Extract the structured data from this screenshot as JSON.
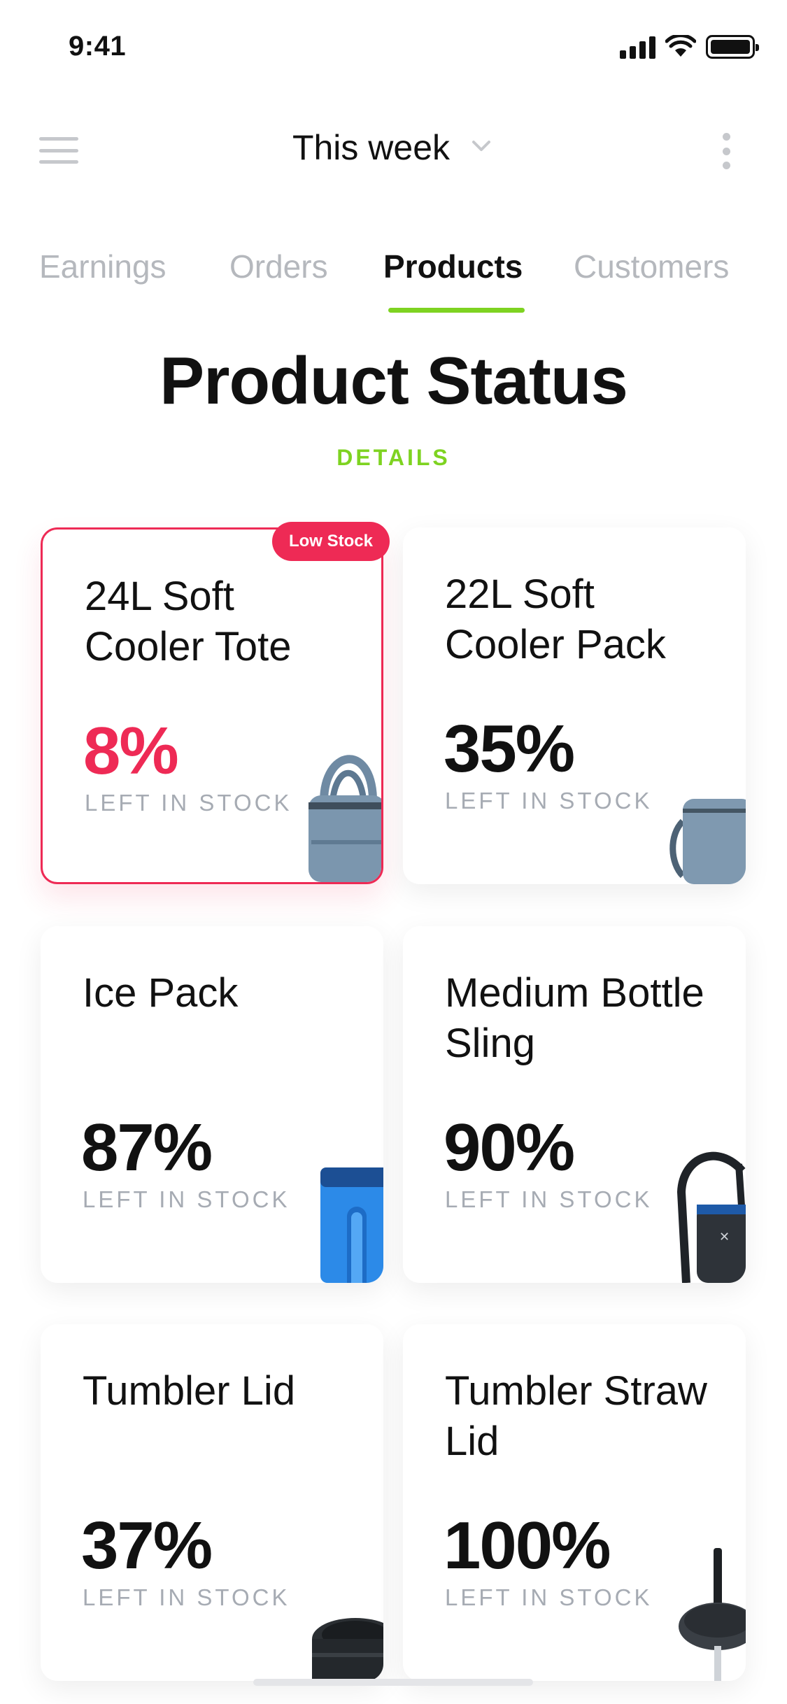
{
  "status_bar": {
    "time": "9:41"
  },
  "header": {
    "period_label": "This week"
  },
  "tabs": [
    {
      "label": "Earnings"
    },
    {
      "label": "Orders"
    },
    {
      "label": "Products"
    },
    {
      "label": "Customers"
    }
  ],
  "page": {
    "title": "Product Status",
    "details_link": "DETAILS"
  },
  "colors": {
    "accent": "#7ed321",
    "alert": "#ee2a55",
    "muted": "#a6abb3"
  },
  "products": [
    {
      "name": "24L Soft Cooler Tote",
      "percent": "8%",
      "stock_label": "LEFT IN STOCK",
      "badge": "Low Stock",
      "icon": "cooler-tote-image"
    },
    {
      "name": "22L Soft Cooler Pack",
      "percent": "35%",
      "stock_label": "LEFT IN STOCK",
      "icon": "cooler-pack-image"
    },
    {
      "name": "Ice Pack",
      "percent": "87%",
      "stock_label": "LEFT IN STOCK",
      "icon": "ice-pack-image"
    },
    {
      "name": "Medium Bottle Sling",
      "percent": "90%",
      "stock_label": "LEFT IN STOCK",
      "icon": "bottle-sling-image"
    },
    {
      "name": "Tumbler Lid",
      "percent": "37%",
      "stock_label": "LEFT IN STOCK",
      "icon": "tumbler-lid-image"
    },
    {
      "name": "Tumbler Straw Lid",
      "percent": "100%",
      "stock_label": "LEFT IN STOCK",
      "icon": "straw-lid-image"
    }
  ]
}
